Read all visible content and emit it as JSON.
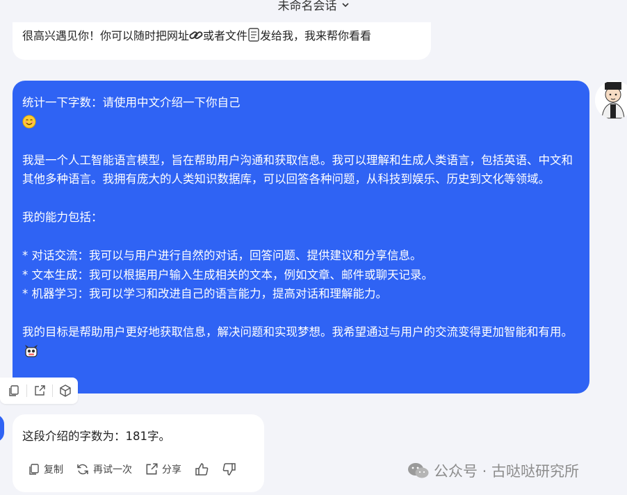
{
  "header": {
    "title": "未命名会话",
    "chevron_icon": "chevron-down-icon"
  },
  "messages": {
    "greeting": {
      "part1": "很高兴遇见你！你可以随时把网址",
      "part2": "或者文件",
      "part3": "发给我，我来帮你看看",
      "link_icon": "link-icon",
      "file_icon": "file-icon"
    },
    "user": {
      "line1": "统计一下字数：请使用中文介绍一下你自己",
      "smile_icon": "smile-emoji-icon",
      "para1": "我是一个人工智能语言模型，旨在帮助用户沟通和获取信息。我可以理解和生成人类语言，包括英语、中文和其他多种语言。我拥有庞大的人类知识数据库，可以回答各种问题，从科技到娱乐、历史到文化等领域。",
      "para2": "我的能力包括：",
      "bullet1": "* 对话交流：我可以与用户进行自然的对话，回答问题、提供建议和分享信息。",
      "bullet2": "* 文本生成：我可以根据用户输入生成相关的文本，例如文章、邮件或聊天记录。",
      "bullet3": "* 机器学习：我可以学习和改进自己的语言能力，提高对话和理解能力。",
      "para3": "我的目标是帮助用户更好地获取信息，解决问题和实现梦想。我希望通过与用户的交流变得更加智能和有用。",
      "robot_icon": "robot-emoji-icon"
    },
    "answer": {
      "text": "这段介绍的字数为：181字。"
    }
  },
  "answer_actions": {
    "copy": "复制",
    "retry": "再试一次",
    "share": "分享"
  },
  "user_actions": [
    "copy-icon",
    "share-icon",
    "cube-icon"
  ],
  "watermark": {
    "text": "公众号 · 古哒哒研究所"
  },
  "colors": {
    "accent": "#2f63f4",
    "background": "#f3f4f9"
  }
}
